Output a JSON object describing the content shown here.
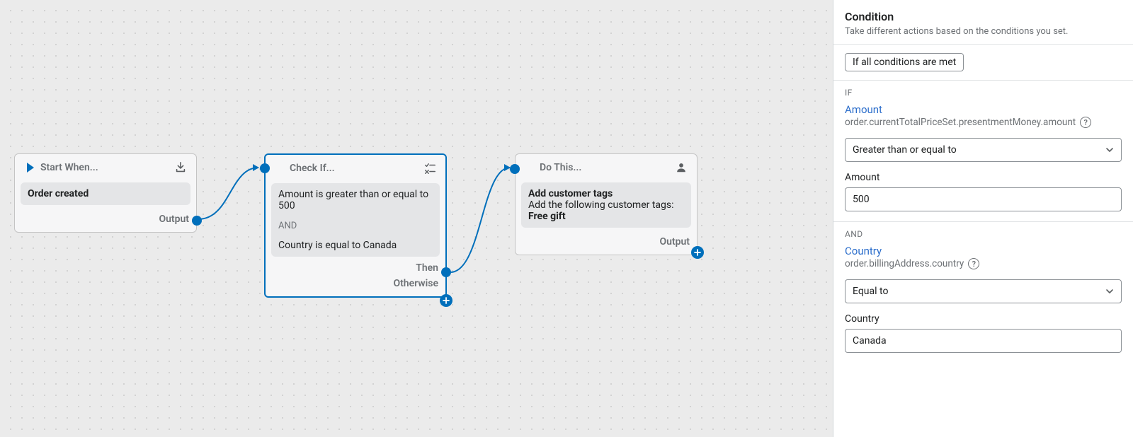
{
  "panel": {
    "title": "Condition",
    "description": "Take different actions based on the conditions you set.",
    "mode_label": "If all conditions are met",
    "if_label": "IF",
    "and_label": "AND",
    "cond1": {
      "link": "Amount",
      "path": "order.currentTotalPriceSet.presentmentMoney.amount",
      "operator": "Greater than or equal to",
      "value_label": "Amount",
      "value": "500"
    },
    "cond2": {
      "link": "Country",
      "path": "order.billingAddress.country",
      "operator": "Equal to",
      "value_label": "Country",
      "value": "Canada"
    }
  },
  "nodes": {
    "start": {
      "header": "Start When...",
      "trigger": "Order created",
      "output_label": "Output"
    },
    "check": {
      "header": "Check If...",
      "line1": "Amount is greater than or equal to 500",
      "and": "AND",
      "line2": "Country is equal to Canada",
      "then_label": "Then",
      "otherwise_label": "Otherwise"
    },
    "action": {
      "header": "Do This...",
      "title": "Add customer tags",
      "subtitle": "Add the following customer tags:",
      "tag": "Free gift",
      "output_label": "Output"
    }
  }
}
